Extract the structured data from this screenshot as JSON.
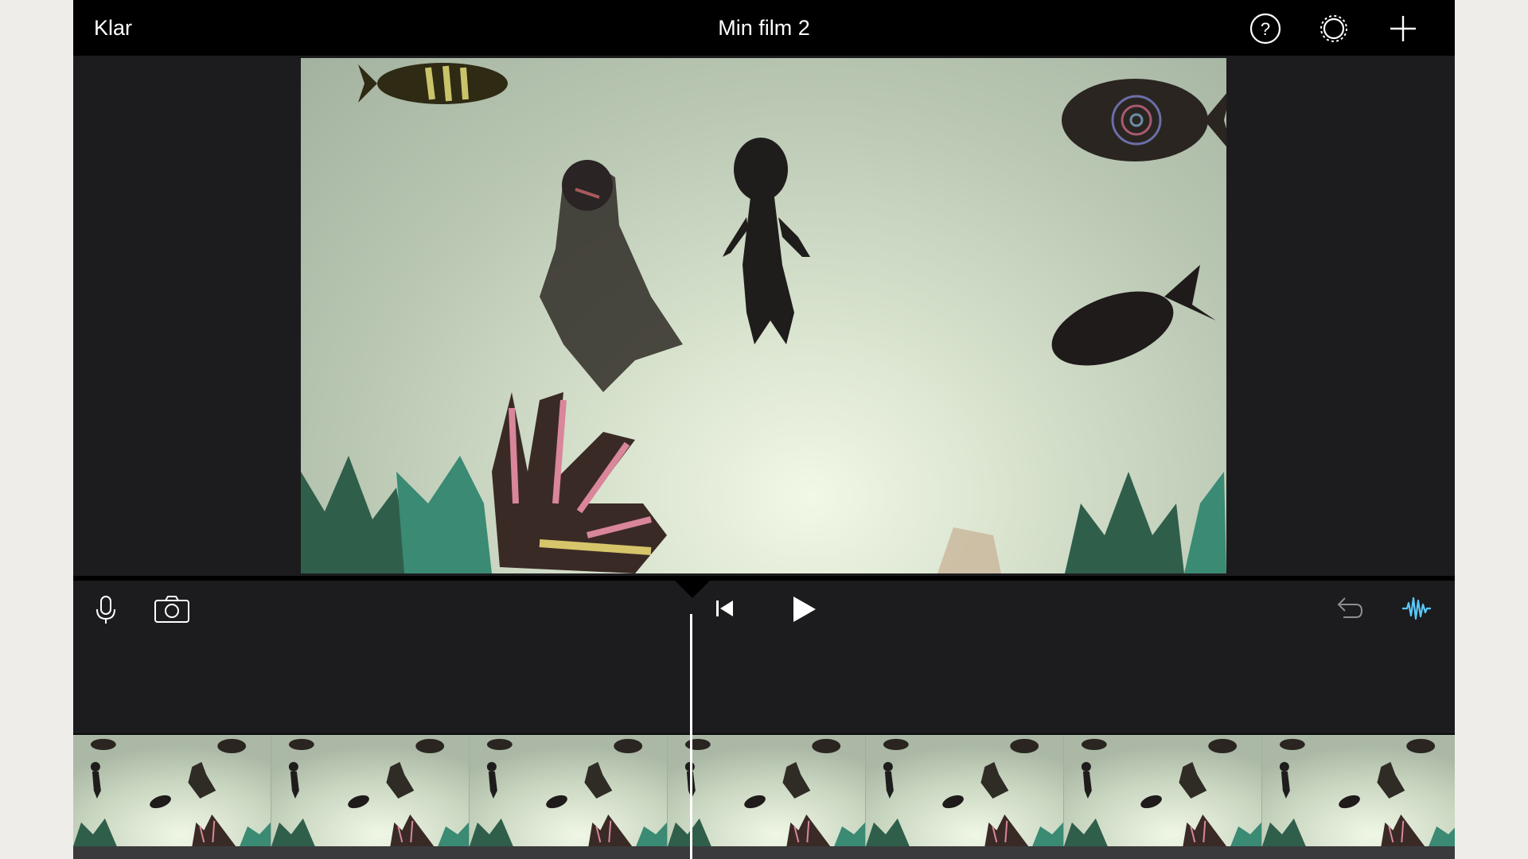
{
  "topbar": {
    "done_label": "Klar",
    "title": "Min film 2",
    "icons": [
      "help-icon",
      "gear-icon",
      "plus-icon"
    ]
  },
  "controls": {
    "left_icons": [
      "microphone-icon",
      "camera-icon"
    ],
    "center_icons": [
      "skip-to-start-icon",
      "play-icon"
    ],
    "right_icons": [
      "undo-icon",
      "audio-waveform-icon"
    ]
  },
  "timeline": {
    "frame_count": 7,
    "playhead_color": "#ffffff"
  },
  "colors": {
    "background": "#1c1c1e",
    "bar": "#000000",
    "accent": "#5ac8fa",
    "text": "#ffffff"
  }
}
